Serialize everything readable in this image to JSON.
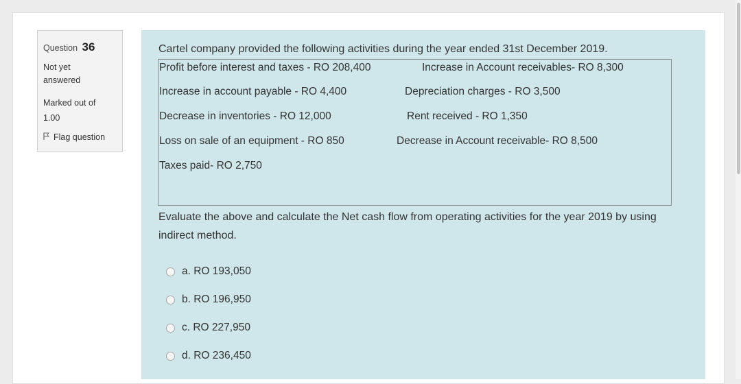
{
  "question_info": {
    "question_label": "Question",
    "question_number": "36",
    "state_line1": "Not yet",
    "state_line2": "answered",
    "marked_line1": "Marked out of",
    "marked_line2": "1.00",
    "flag_label": "Flag question"
  },
  "stem": {
    "intro": "Cartel company provided the following activities during the year ended 31st December 2019.",
    "rows": [
      {
        "left": "Profit before interest and taxes - RO 208,400",
        "right": "Increase in Account receivables- RO 8,300"
      },
      {
        "left": "Increase in account payable - RO 4,400",
        "right": "Depreciation charges - RO 3,500"
      },
      {
        "left": "Decrease in inventories - RO 12,000",
        "right": "Rent received - RO 1,350"
      },
      {
        "left": "Loss on sale of an equipment - RO 850",
        "right": "Decrease in Account receivable- RO 8,500"
      },
      {
        "left": "Taxes paid- RO 2,750",
        "right": ""
      }
    ],
    "question": "Evaluate the above and calculate the Net cash flow from operating activities for the year 2019 by using indirect method."
  },
  "options": [
    {
      "label": "a. RO 193,050"
    },
    {
      "label": "b. RO 196,950"
    },
    {
      "label": "c. RO 227,950"
    },
    {
      "label": "d. RO 236,450"
    }
  ],
  "colors": {
    "content_bg": "#cfe6ea",
    "info_bg": "#f3f3f3",
    "text": "#333333"
  }
}
